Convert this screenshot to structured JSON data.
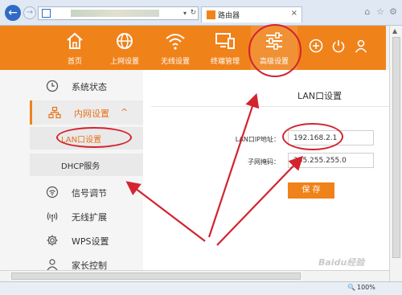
{
  "browser": {
    "tab_label": "路由器",
    "zoom": "100%"
  },
  "nav": [
    {
      "label": "首页",
      "icon": "home-icon"
    },
    {
      "label": "上网设置",
      "icon": "globe-icon"
    },
    {
      "label": "无线设置",
      "icon": "wifi-icon"
    },
    {
      "label": "终端管理",
      "icon": "devices-icon"
    },
    {
      "label": "高级设置",
      "icon": "sliders-icon"
    }
  ],
  "sidebar": {
    "items": [
      {
        "label": "系统状态",
        "icon": "clock-icon"
      },
      {
        "label": "内网设置",
        "icon": "network-icon",
        "chevron": "^"
      },
      {
        "label": "信号调节",
        "icon": "signal-icon"
      },
      {
        "label": "无线扩展",
        "icon": "antenna-icon"
      },
      {
        "label": "WPS设置",
        "icon": "gear-icon"
      },
      {
        "label": "家长控制",
        "icon": "user-icon"
      }
    ],
    "subitems": [
      {
        "label": "LAN口设置"
      },
      {
        "label": "DHCP服务"
      }
    ]
  },
  "main": {
    "title": "LAN口设置",
    "lan_ip_label": "LAN口IP地址：",
    "lan_ip_value": "192.168.2.1",
    "subnet_label": "子网掩码：",
    "subnet_value": "255.255.255.0",
    "save_label": "保 存"
  },
  "watermark": "Baidu经验",
  "colors": {
    "accent": "#f0821a",
    "annotation": "#d3232f"
  }
}
